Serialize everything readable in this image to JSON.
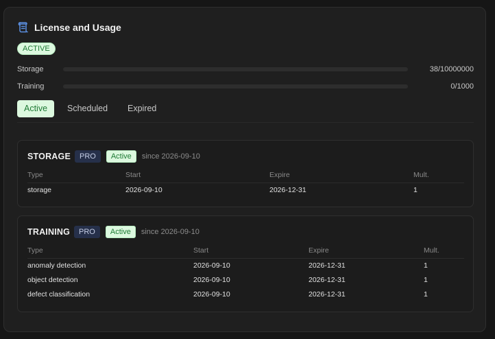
{
  "header": {
    "title": "License and Usage",
    "icon": "license-scroll-icon",
    "accent": "#46c06a"
  },
  "status": "ACTIVE",
  "usage": [
    {
      "label": "Storage",
      "value": "38/10000000",
      "fraction": 3.8e-06
    },
    {
      "label": "Training",
      "value": "0/1000",
      "fraction": 0
    }
  ],
  "tabs": [
    {
      "label": "Active",
      "selected": true
    },
    {
      "label": "Scheduled",
      "selected": false
    },
    {
      "label": "Expired",
      "selected": false
    }
  ],
  "storage_card": {
    "name": "STORAGE",
    "tier": "PRO",
    "status": "Active",
    "since": "since 2026-09-10",
    "columns": [
      "Type",
      "Start",
      "Expire",
      "Mult."
    ],
    "rows": [
      [
        "storage",
        "2026-09-10",
        "2026-12-31",
        "1"
      ]
    ]
  },
  "training_card": {
    "name": "TRAINING",
    "tier": "PRO",
    "status": "Active",
    "since": "since 2026-09-10",
    "columns": [
      "Type",
      "Start",
      "Expire",
      "Mult."
    ],
    "rows": [
      [
        "anomaly detection",
        "2026-09-10",
        "2026-12-31",
        "1"
      ],
      [
        "object detection",
        "2026-09-10",
        "2026-12-31",
        "1"
      ],
      [
        "defect classification",
        "2026-09-10",
        "2026-12-31",
        "1"
      ]
    ]
  }
}
